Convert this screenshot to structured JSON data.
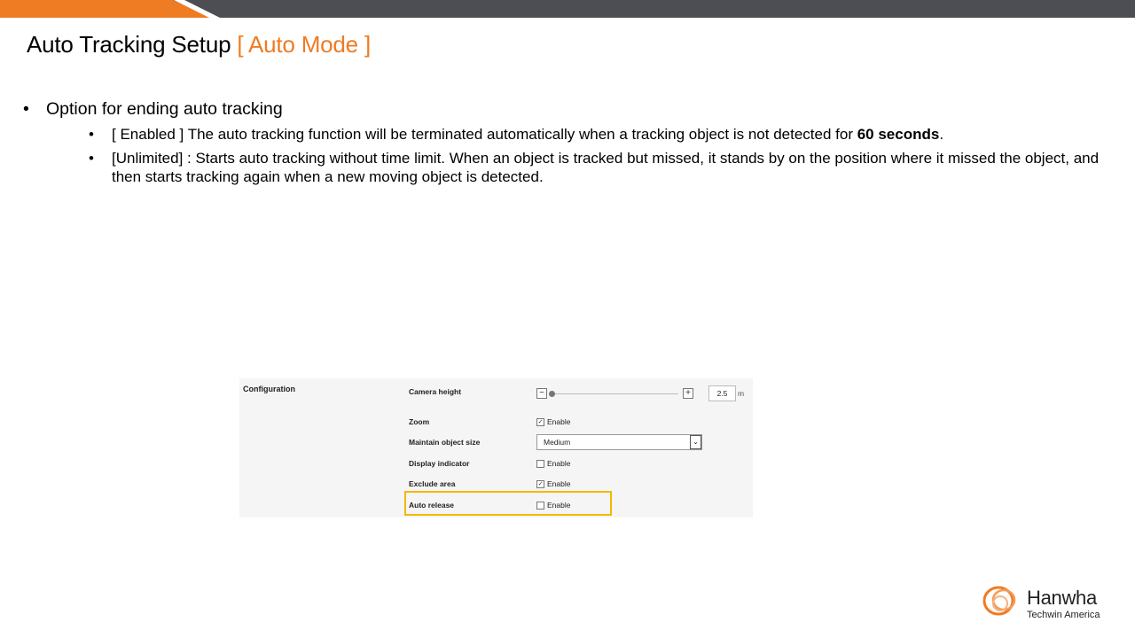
{
  "header": {
    "title": "Auto Tracking Setup",
    "title_accent": "[ Auto Mode ]",
    "accent_color": "#ef7b22",
    "bar_color": "#4d4e53"
  },
  "bullets": {
    "main": "Option for ending auto tracking",
    "enabled_prefix": "[ Enabled ] The auto tracking function will be terminated automatically when a tracking object is not detected for ",
    "enabled_bold": "60 seconds",
    "enabled_suffix": ".",
    "unlimited": "[Unlimited] : Starts auto tracking without time limit. When an object is tracked but missed, it stands by on the position where it missed the object, and then starts tracking again when a new moving object is detected."
  },
  "config": {
    "section_title": "Configuration",
    "camera_height_label": "Camera height",
    "camera_height_value": "2.5",
    "camera_height_unit": "m",
    "zoom_label": "Zoom",
    "zoom_option": "Enable",
    "zoom_checked": true,
    "maintain_label": "Maintain object size",
    "maintain_value": "Medium",
    "display_label": "Display indicator",
    "display_option": "Enable",
    "display_checked": false,
    "exclude_label": "Exclude area",
    "exclude_option": "Enable",
    "exclude_checked": true,
    "auto_release_label": "Auto release",
    "auto_release_option": "Enable",
    "auto_release_checked": false,
    "highlight_color": "#f4b800"
  },
  "logo": {
    "name": "Hanwha",
    "subtitle": "Techwin America"
  }
}
